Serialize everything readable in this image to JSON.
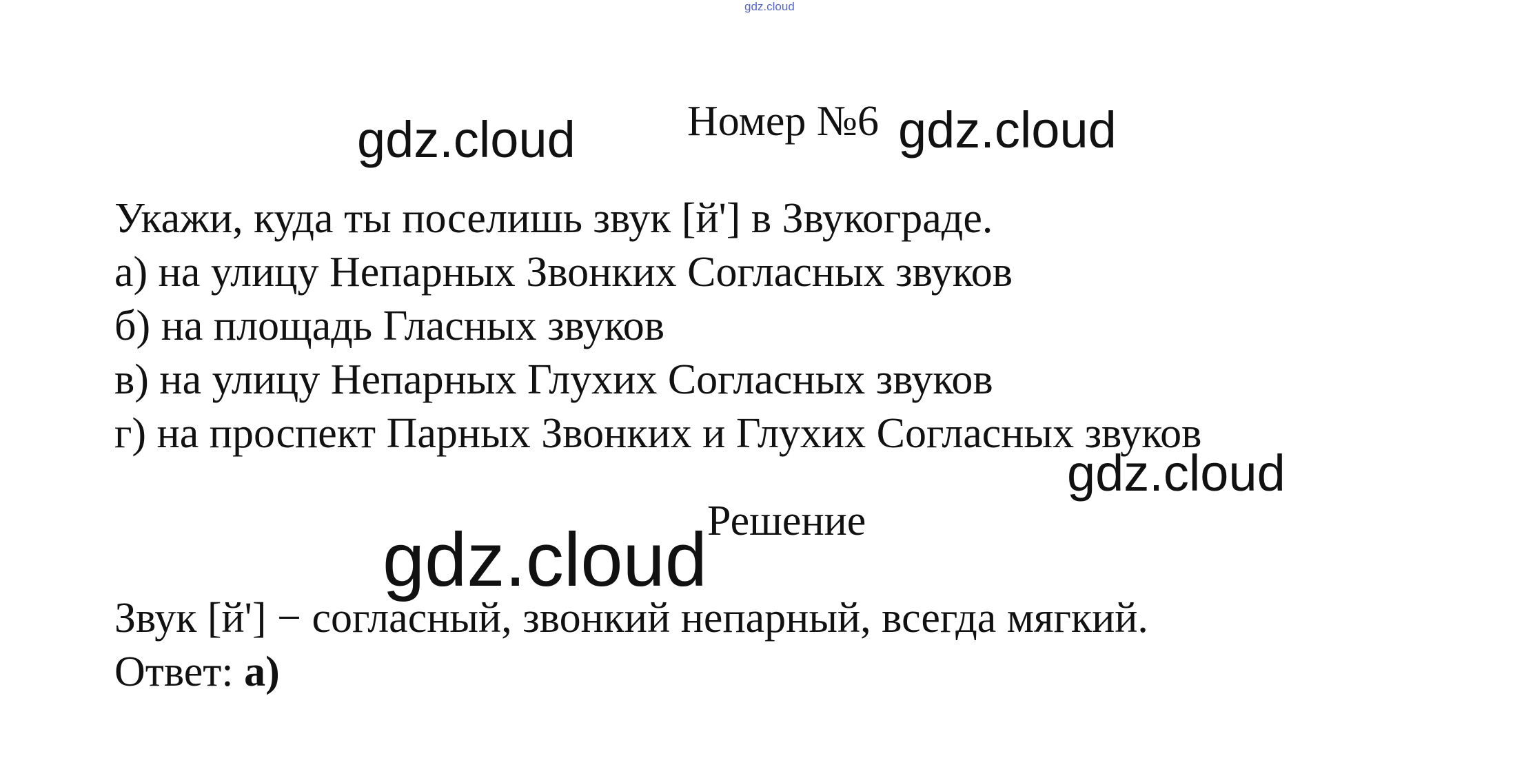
{
  "watermark_small": "gdz.cloud",
  "watermarks": [
    "gdz.cloud",
    "gdz.cloud",
    "gdz.cloud",
    "gdz.cloud"
  ],
  "title": "Номер №6",
  "task": {
    "question": "Укажи, куда ты поселишь звук [й'] в Звукограде.",
    "options": [
      "а) на улицу Непарных Звонких Согласных звуков",
      "б) на площадь Гласных звуков",
      "в) на улицу Непарных Глухих Согласных звуков",
      "г) на проспект Парных Звонких и Глухих Согласных звуков"
    ]
  },
  "solution": {
    "heading": "Решение",
    "explanation": "Звук [й'] − согласный, звонкий непарный, всегда мягкий.",
    "answer_label": "Ответ: ",
    "answer_value": "а)"
  }
}
